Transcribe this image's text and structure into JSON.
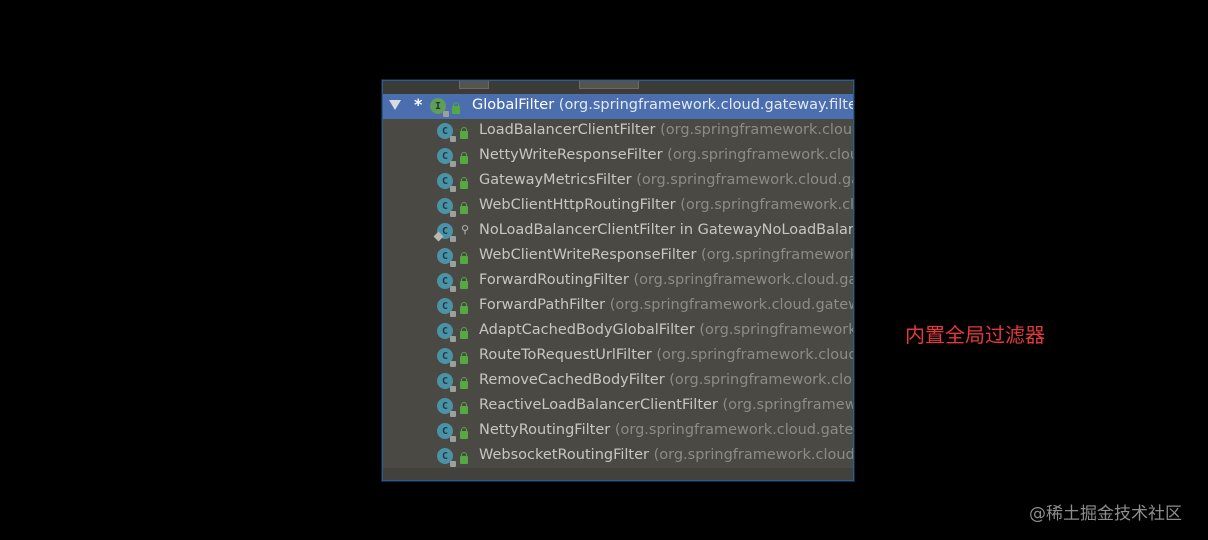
{
  "tree": {
    "root": {
      "name": "GlobalFilter",
      "package": "(org.springframework.cloud.gateway.filter)",
      "icon": "interface-icon",
      "marker": "*"
    },
    "children": [
      {
        "name": "LoadBalancerClientFilter",
        "package": "(org.springframework.cloud.ga",
        "icon": "class-icon"
      },
      {
        "name": "NettyWriteResponseFilter",
        "package": "(org.springframework.cloud.g",
        "icon": "class-icon"
      },
      {
        "name": "GatewayMetricsFilter",
        "package": "(org.springframework.cloud.gatew",
        "icon": "class-icon"
      },
      {
        "name": "WebClientHttpRoutingFilter",
        "package": "(org.springframework.cloud",
        "icon": "class-icon"
      },
      {
        "name": "NoLoadBalancerClientFilter in GatewayNoLoadBalancer",
        "package": "",
        "icon": "inner-class-icon"
      },
      {
        "name": "WebClientWriteResponseFilter",
        "package": "(org.springframework.cloud",
        "icon": "class-icon"
      },
      {
        "name": "ForwardRoutingFilter",
        "package": "(org.springframework.cloud.gatew",
        "icon": "class-icon"
      },
      {
        "name": "ForwardPathFilter",
        "package": "(org.springframework.cloud.gateway.",
        "icon": "class-icon"
      },
      {
        "name": "AdaptCachedBodyGlobalFilter",
        "package": "(org.springframework.clo",
        "icon": "class-icon"
      },
      {
        "name": "RouteToRequestUrlFilter",
        "package": "(org.springframework.cloud.ga",
        "icon": "class-icon"
      },
      {
        "name": "RemoveCachedBodyFilter",
        "package": "(org.springframework.cloud.g",
        "icon": "class-icon"
      },
      {
        "name": "ReactiveLoadBalancerClientFilter",
        "package": "(org.springframework.",
        "icon": "class-icon"
      },
      {
        "name": "NettyRoutingFilter",
        "package": "(org.springframework.cloud.gateway",
        "icon": "class-icon"
      },
      {
        "name": "WebsocketRoutingFilter",
        "package": "(org.springframework.cloud.ga",
        "icon": "class-icon"
      }
    ]
  },
  "annotation": "内置全局过滤器",
  "watermark": "@稀土掘金技术社区",
  "colors": {
    "selection": "#4b6eaf",
    "panel_bg": "#4a4944",
    "annotation": "#e5383a"
  }
}
